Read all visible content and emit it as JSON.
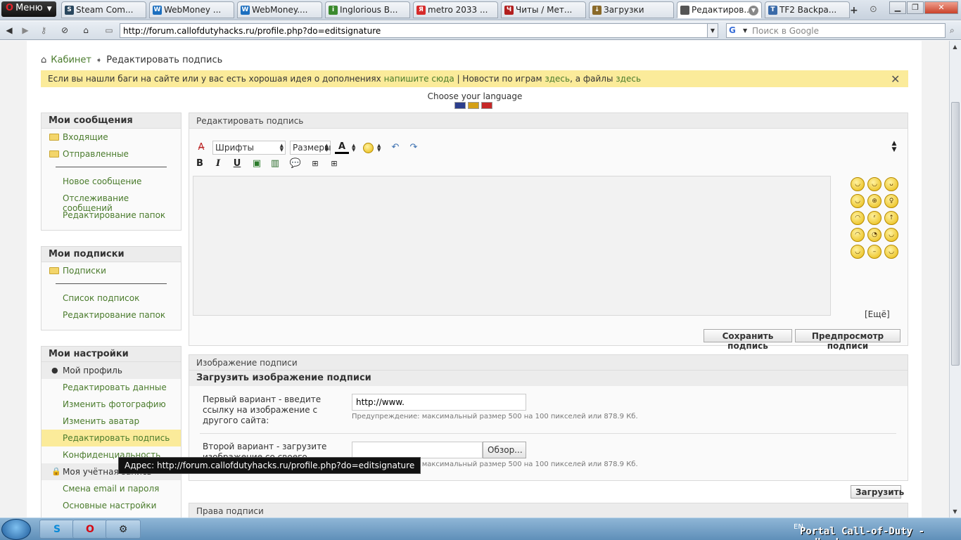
{
  "browser": {
    "menu_label": "Меню",
    "tabs": [
      {
        "title": "Steam Com...",
        "icon_color": "#2a475e"
      },
      {
        "title": "WebMoney ...",
        "icon_color": "#1c6fbf"
      },
      {
        "title": "WebMoney....",
        "icon_color": "#1c6fbf"
      },
      {
        "title": "Inglorious B...",
        "icon_color": "#3b8a2e"
      },
      {
        "title": "metro 2033 ...",
        "icon_color": "#d62b2b"
      },
      {
        "title": "Читы / Мет...",
        "icon_color": "#b21f1f"
      },
      {
        "title": "Загрузки",
        "icon_color": "#8a6a2a"
      },
      {
        "title": "Редактиров...",
        "icon_color": "#555555"
      },
      {
        "title": "TF2 Backpa...",
        "icon_color": "#3a6aa8"
      }
    ],
    "tab_icon_letters": [
      "S",
      "W",
      "W",
      "i",
      "Я",
      "Ч",
      "↓",
      "",
      "T"
    ],
    "url": "http://forum.callofdutyhacks.ru/profile.php?do=editsignature",
    "search_placeholder": "Поиск в Google",
    "search_engine_letter": "G"
  },
  "breadcrumb": {
    "home_label": "Кабинет",
    "current": "Редактировать подпись"
  },
  "notice": {
    "text_1": "Если вы нашли баги на сайте или у вас есть хорошая идея о дополнениях",
    "link_1": "напишите сюда",
    "text_2": "| Новости по играм",
    "link_2": "здесь",
    "text_3": ", а файлы",
    "link_3": "здесь"
  },
  "language": {
    "label": "Choose your language",
    "flags": [
      {
        "name": "english",
        "color": "#2c3e8c"
      },
      {
        "name": "german",
        "color": "#d4a017"
      },
      {
        "name": "russian",
        "color": "#c62828"
      }
    ]
  },
  "sidebar": {
    "messages": {
      "title": "Мои сообщения",
      "items": [
        "Входящие",
        "Отправленные"
      ],
      "links": [
        "Новое сообщение",
        "Отслеживание сообщений",
        "Редактирование папок"
      ]
    },
    "subscriptions": {
      "title": "Мои подписки",
      "items": [
        "Подписки"
      ],
      "links": [
        "Список подписок",
        "Редактирование папок"
      ]
    },
    "settings": {
      "title": "Мои настройки",
      "profile": "Мой профиль",
      "profile_links": [
        "Редактировать данные",
        "Изменить фотографию",
        "Изменить аватар",
        "Редактировать подпись",
        "Конфиденциальность"
      ],
      "account": "Моя учётная запись",
      "account_links": [
        "Смена email и пароля",
        "Основные настройки"
      ]
    }
  },
  "editor_panel": {
    "title": "Редактировать подпись",
    "fonts_label": "Шрифты",
    "sizes_label": "Размеры",
    "bold": "B",
    "italic": "I",
    "underline": "U",
    "more_smilies": "[Ещё]",
    "save_button": "Сохранить подпись",
    "preview_button": "Предпросмотр подписи"
  },
  "image_panel": {
    "title": "Изображение подписи",
    "subtitle": "Загрузить изображение подписи",
    "option1_label": "Первый вариант - введите ссылку на изображение с другого сайта:",
    "option1_value": "http://www.",
    "warning": "Предупреждение: максимальный размер 500 на 100 пикселей или 878.9 Кб.",
    "option2_label": "Второй вариант - загрузите изображение со своего",
    "browse_button": "Обзор...",
    "upload_button": "Загрузить"
  },
  "rights_panel": {
    "title": "Права подписи"
  },
  "tooltip": "Адрес: http://forum.callofdutyhacks.ru/profile.php?do=editsignature",
  "taskbar": {
    "tray_lang": "EN",
    "watermark": "Portal Call-of-Duty - codhacks.ru"
  }
}
